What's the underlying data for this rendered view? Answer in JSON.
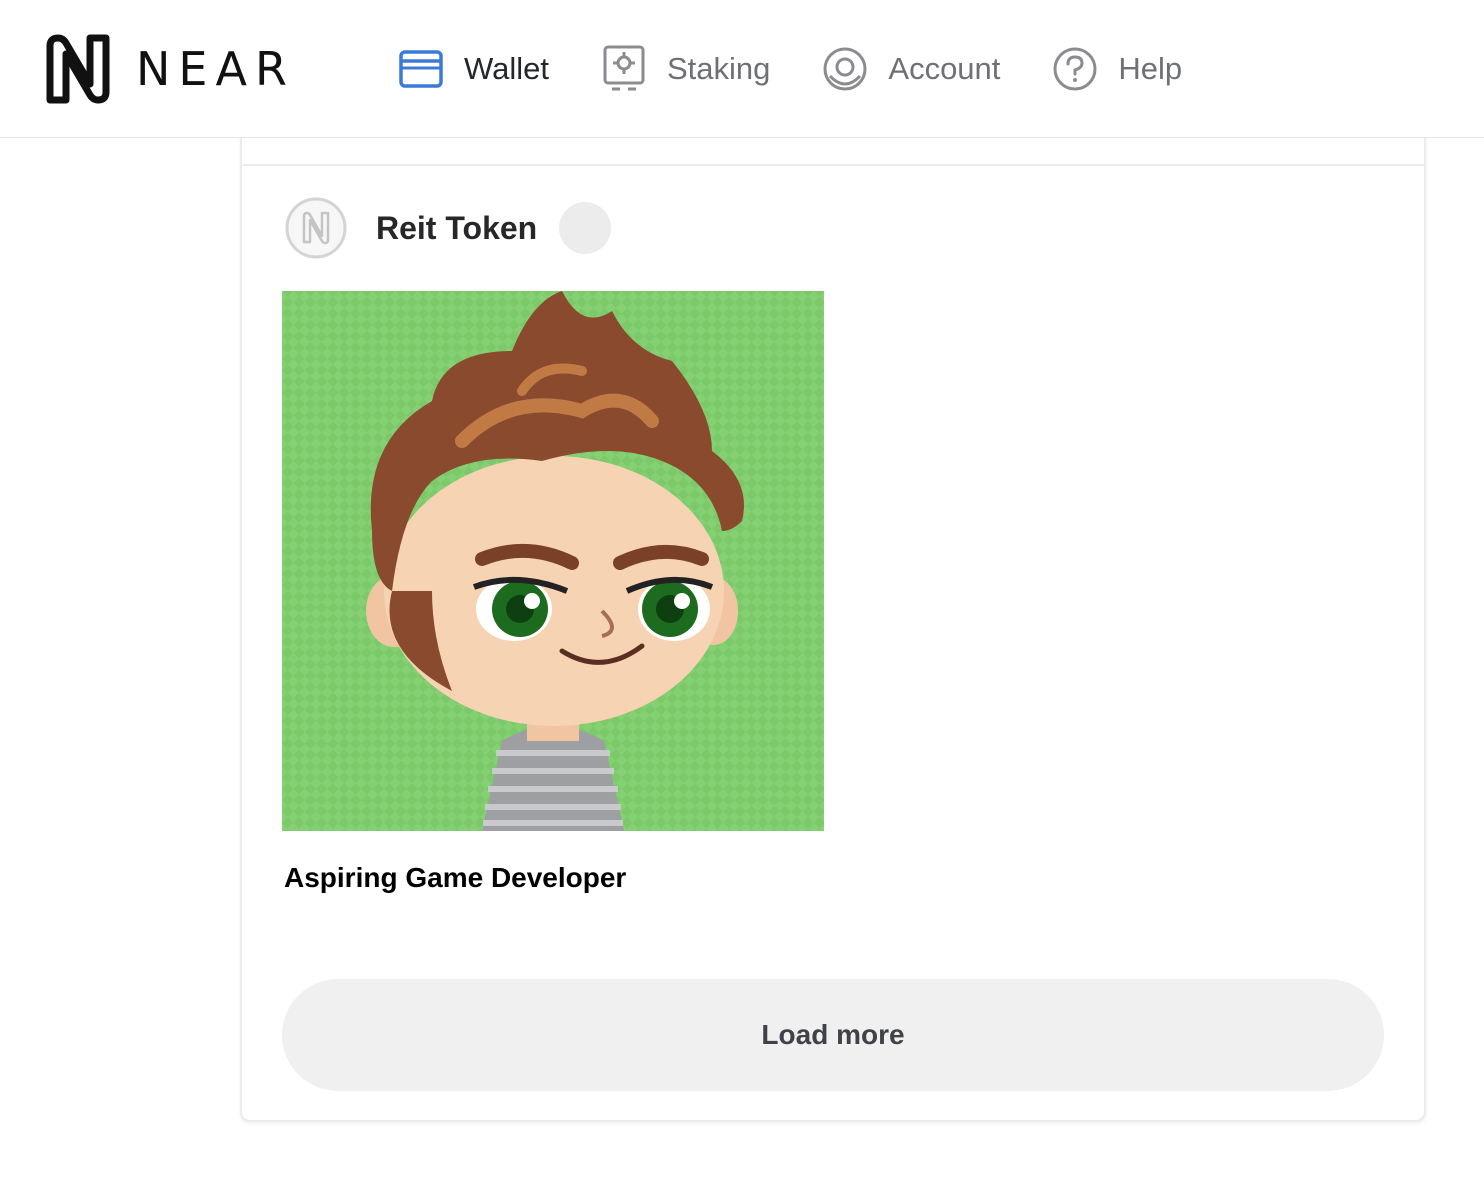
{
  "brand": {
    "name": "NEAR"
  },
  "nav": {
    "items": [
      {
        "label": "Wallet",
        "icon": "wallet-icon",
        "active": true
      },
      {
        "label": "Staking",
        "icon": "staking-icon",
        "active": false
      },
      {
        "label": "Account",
        "icon": "account-icon",
        "active": false
      },
      {
        "label": "Help",
        "icon": "help-icon",
        "active": false
      }
    ]
  },
  "collection": {
    "name": "Reit Token",
    "icon": "near-token-icon"
  },
  "nft": {
    "title": "Aspiring Game Developer",
    "image": "avatar-image"
  },
  "actions": {
    "load_more_label": "Load more"
  },
  "colors": {
    "accent": "#3b7ad7",
    "nav_inactive": "#6e7073",
    "button_bg": "#f0f0f0",
    "image_bg": "#7cc96a"
  }
}
